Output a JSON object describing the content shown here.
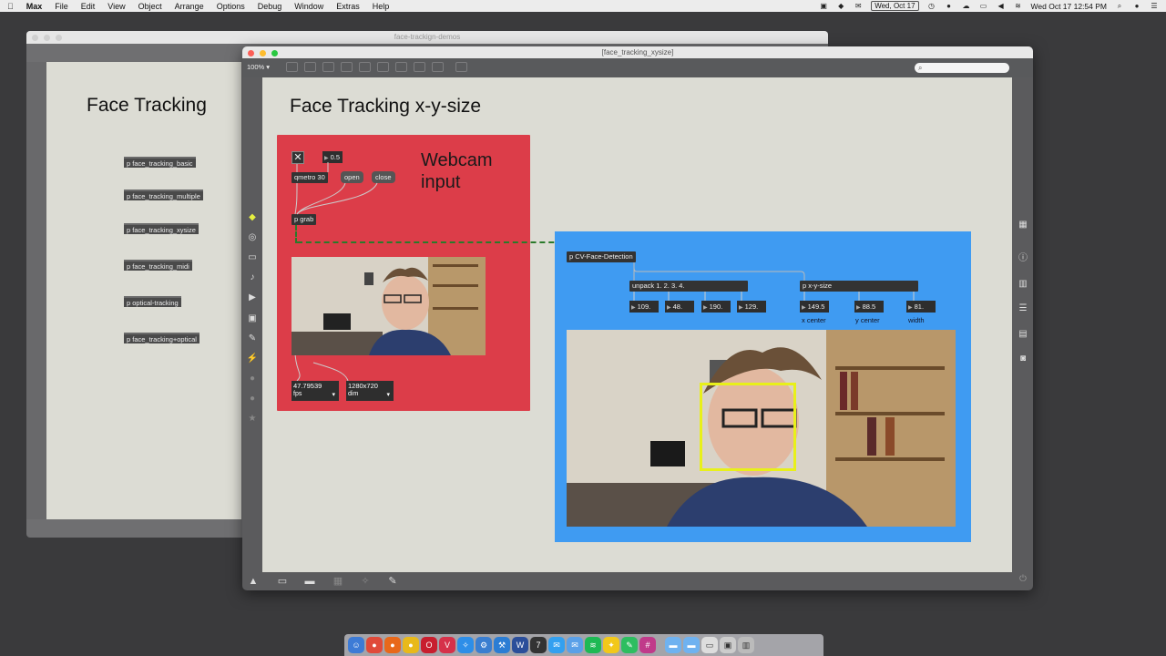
{
  "menubar": {
    "apple": "",
    "app": "Max",
    "items": [
      "File",
      "Edit",
      "View",
      "Object",
      "Arrange",
      "Options",
      "Debug",
      "Window",
      "Extras",
      "Help"
    ],
    "date_badge": "Wed, Oct 17",
    "clock": "Wed Oct 17  12:54 PM"
  },
  "back_window": {
    "title": "face-trackign-demos",
    "heading": "Face Tracking",
    "subpatchers": [
      "p face_tracking_basic",
      "p face_tracking_multiple",
      "p face_tracking_xysize",
      "p face_tracking_midi",
      "p optical-tracking",
      "p face_tracking+optical"
    ]
  },
  "front_window": {
    "title": "[face_tracking_xysize]",
    "zoom": "100%",
    "search_icon": "magnifier",
    "heading": "Face Tracking x-y-size",
    "webcam_label_1": "Webcam",
    "webcam_label_2": "input",
    "toggle_value": "0.5",
    "metro": "qmetro 30",
    "open_btn": "open",
    "close_btn": "close",
    "grab": "p grab",
    "fps_value": "47.79539",
    "fps_menu": "fps",
    "dim_value": "1280x720",
    "dim_menu": "dim",
    "cv_object": "p CV-Face-Detection",
    "unpack": "unpack 1. 2. 3. 4.",
    "xysize": "p x-y-size",
    "unpack_values": [
      "109.",
      "48.",
      "190.",
      "129."
    ],
    "xy_values": [
      "149.5",
      "88.5",
      "81."
    ],
    "xy_labels": [
      "x center",
      "y center",
      "width"
    ]
  },
  "colors": {
    "red_panel": "#dc3d49",
    "blue_panel": "#3f9bf2",
    "face_box": "#e8f01a",
    "canvas": "#dcdcd4"
  },
  "dock_icons": [
    "finder",
    "chrome",
    "firefox",
    "chrome-canary",
    "opera",
    "vivaldi",
    "safari",
    "network",
    "xcode",
    "word",
    "max",
    "messages",
    "mail",
    "spotify",
    "lightbulb",
    "evernote",
    "slack",
    "folder",
    "folder",
    "screenshot",
    "preview",
    "trash"
  ]
}
